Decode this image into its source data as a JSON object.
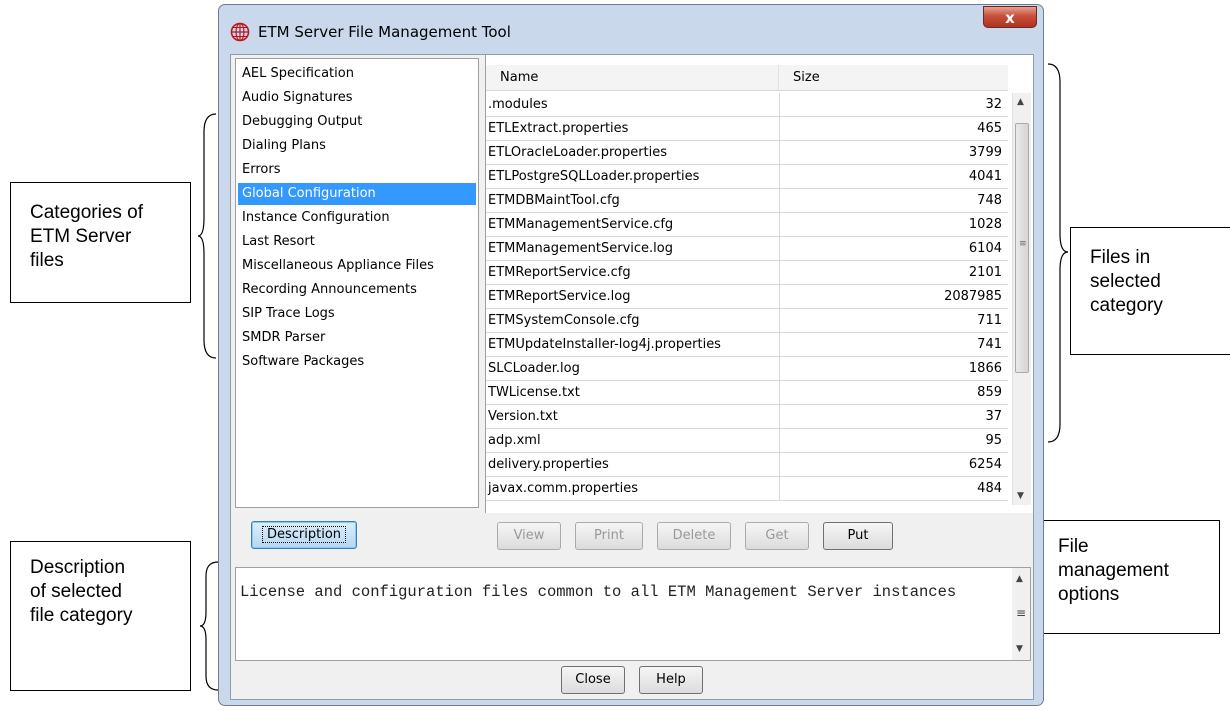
{
  "window": {
    "title": "ETM Server File Management Tool",
    "close_glyph": "x"
  },
  "categories": {
    "items": [
      "AEL Specification",
      "Audio Signatures",
      "Debugging Output",
      "Dialing Plans",
      "Errors",
      "Global Configuration",
      "Instance Configuration",
      "Last Resort",
      "Miscellaneous Appliance Files",
      "Recording Announcements",
      "SIP Trace Logs",
      "SMDR Parser",
      "Software Packages"
    ],
    "selected": "Global Configuration",
    "description_button": "Description"
  },
  "files": {
    "columns": [
      "Name",
      "Size"
    ],
    "rows": [
      {
        "name": ".modules",
        "size": "32"
      },
      {
        "name": "ETLExtract.properties",
        "size": "465"
      },
      {
        "name": "ETLOracleLoader.properties",
        "size": "3799"
      },
      {
        "name": "ETLPostgreSQLLoader.properties",
        "size": "4041"
      },
      {
        "name": "ETMDBMaintTool.cfg",
        "size": "748"
      },
      {
        "name": "ETMManagementService.cfg",
        "size": "1028"
      },
      {
        "name": "ETMManagementService.log",
        "size": "6104"
      },
      {
        "name": "ETMReportService.cfg",
        "size": "2101"
      },
      {
        "name": "ETMReportService.log",
        "size": "2087985"
      },
      {
        "name": "ETMSystemConsole.cfg",
        "size": "711"
      },
      {
        "name": "ETMUpdateInstaller-log4j.properties",
        "size": "741"
      },
      {
        "name": "SLCLoader.log",
        "size": "1866"
      },
      {
        "name": "TWLicense.txt",
        "size": "859"
      },
      {
        "name": "Version.txt",
        "size": "37"
      },
      {
        "name": "adp.xml",
        "size": "95"
      },
      {
        "name": "delivery.properties",
        "size": "6254"
      },
      {
        "name": "javax.comm.properties",
        "size": "484"
      }
    ]
  },
  "file_actions": {
    "view": "View",
    "print": "Print",
    "delete": "Delete",
    "get": "Get",
    "put": "Put"
  },
  "description": {
    "text": "License and configuration files common to all ETM Management Server instances"
  },
  "footer": {
    "close": "Close",
    "help": "Help"
  },
  "callouts": {
    "categories": [
      "Categories of",
      "ETM Server",
      "files"
    ],
    "files": [
      "Files in",
      "selected",
      "category"
    ],
    "description": [
      "Description",
      "of selected",
      "file category"
    ],
    "options": [
      "File",
      "management",
      "options"
    ]
  },
  "icons": {
    "app": "globe-logo-icon",
    "scroll_up": "up-arrow-icon",
    "scroll_down": "down-arrow-icon"
  },
  "colors": {
    "selection": "#3399ff",
    "window_frame": "#c9d8ea",
    "logo_red": "#c0141c"
  }
}
